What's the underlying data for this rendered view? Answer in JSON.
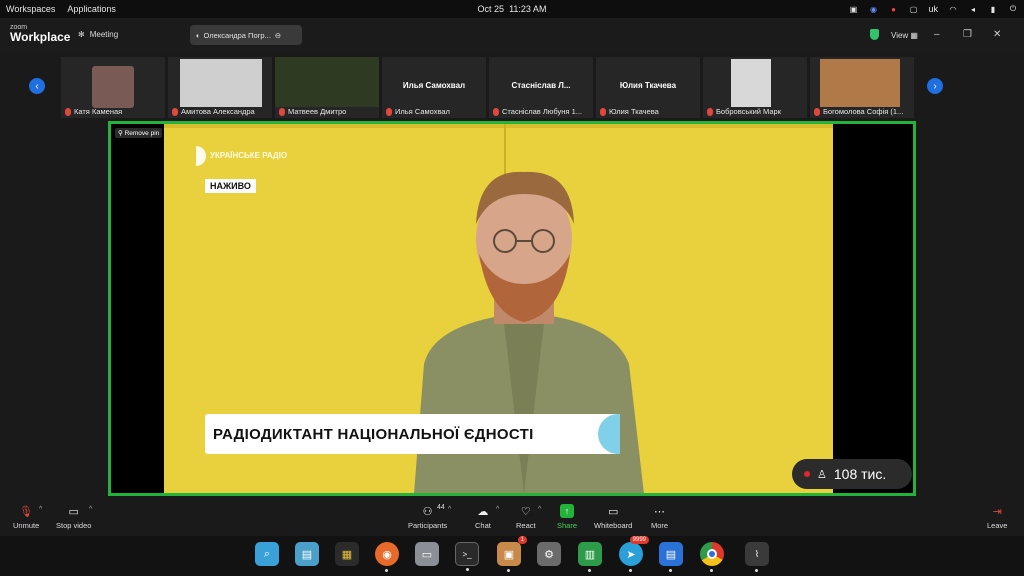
{
  "system": {
    "menu_workspaces": "Workspaces",
    "menu_applications": "Applications",
    "date": "Oct 25",
    "time": "11:23 AM",
    "lang": "uk"
  },
  "zoom": {
    "logo_top": "zoom",
    "logo_bottom": "Workplace",
    "meeting_label": "Meeting",
    "speaker_pill": "Олександра Погр...",
    "view_label": "View"
  },
  "thumbnails": [
    {
      "name": "Катя Каменая",
      "center": ""
    },
    {
      "name": "Амитова Александра",
      "center": ""
    },
    {
      "name": "Матвеев Дмитро",
      "center": ""
    },
    {
      "name": "Илья Самохвал",
      "center": "Илья Самохвал"
    },
    {
      "name": "Стасніслав Любуня 1...",
      "center": "Стасніслав Л..."
    },
    {
      "name": "Юлия Ткачева",
      "center": "Юлия Ткачева"
    },
    {
      "name": "Бобровський Марк",
      "center": ""
    },
    {
      "name": "Богомолова Софія (1...",
      "center": ""
    }
  ],
  "stage": {
    "remove_pin": "Remove pin",
    "radio_logo": "УКРАЇНСЬКЕ РАДІО",
    "live_badge": "НАЖИВО",
    "banner_text": "РАДІОДИКТАНТ НАЦІОНАЛЬНОЇ ЄДНОСТІ",
    "viewers": "108 тис."
  },
  "toolbar": {
    "unmute": "Unmute",
    "stop_video": "Stop video",
    "participants": "Participants",
    "participants_count": "44",
    "chat": "Chat",
    "react": "React",
    "share": "Share",
    "whiteboard": "Whiteboard",
    "more": "More",
    "leave": "Leave"
  },
  "dock": {
    "apps": [
      "image-viewer",
      "files-panel",
      "app-grid",
      "firefox",
      "file-manager",
      "terminal",
      "archive",
      "settings",
      "spreadsheet",
      "telegram",
      "document",
      "chrome",
      "system-monitor"
    ],
    "archive_badge": "1",
    "telegram_badge": "9999"
  },
  "colors": {
    "accent_green": "#23b33a",
    "nav_blue": "#1f6fe0",
    "live_red": "#e0282b"
  }
}
